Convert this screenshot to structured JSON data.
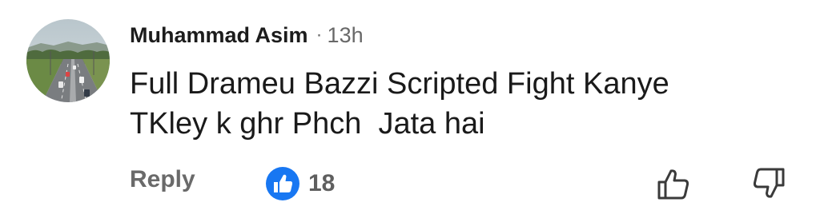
{
  "comment": {
    "author": "Muhammad Asim",
    "separator": "·",
    "time": "13h",
    "text": "Full Drameu Bazzi Scripted Fight Kanye\nTKley k ghr Phch  Jata hai",
    "reply_label": "Reply",
    "reaction": {
      "icon": "like-reaction-icon",
      "count": "18"
    },
    "actions": {
      "like_icon": "thumbs-up-outline-icon",
      "dislike_icon": "thumbs-down-outline-icon"
    }
  },
  "colors": {
    "author_text": "#1c1c1c",
    "meta_text": "#686868",
    "reaction_blue": "#1877f2"
  }
}
